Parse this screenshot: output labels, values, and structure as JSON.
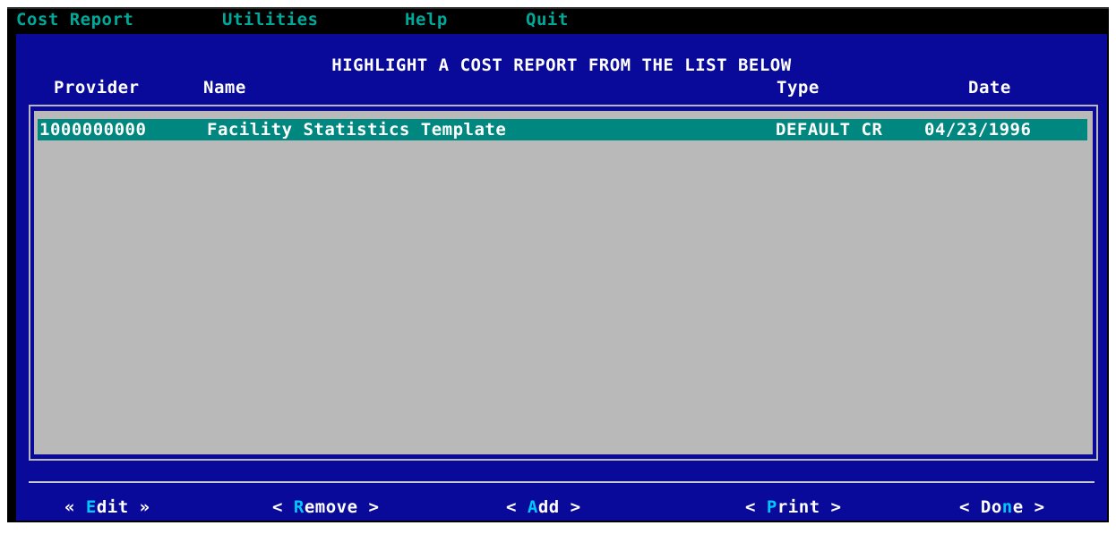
{
  "menu": {
    "items": [
      "Cost Report",
      "Utilities",
      "Help",
      "Quit"
    ]
  },
  "dialog": {
    "heading": "HIGHLIGHT A COST REPORT FROM THE LIST BELOW",
    "columns": {
      "provider": "Provider",
      "name": "Name",
      "type": "Type",
      "date": "Date"
    }
  },
  "reports": [
    {
      "provider": "1000000000",
      "name": "Facility Statistics Template",
      "type": "DEFAULT CR",
      "date": "04/23/1996",
      "selected": true
    }
  ],
  "buttons": {
    "edit": {
      "left": "« ",
      "hot": "E",
      "rest": "dit",
      "right": " »"
    },
    "remove": {
      "left": "< ",
      "hot": "R",
      "rest": "emove",
      "right": " >"
    },
    "add": {
      "left": "< ",
      "hot": "A",
      "rest": "dd",
      "right": " >"
    },
    "print": {
      "left": "< ",
      "hot": "P",
      "rest": "rint",
      "right": " >"
    },
    "done": {
      "left": "< Do",
      "hot": "n",
      "rest": "e",
      "right": " >"
    }
  },
  "colors": {
    "panel": "#0a0a9a",
    "menu_text": "#00a89a",
    "selection": "#00877f",
    "list_bg": "#b9b9b9",
    "hotkey": "#00c8ff"
  }
}
